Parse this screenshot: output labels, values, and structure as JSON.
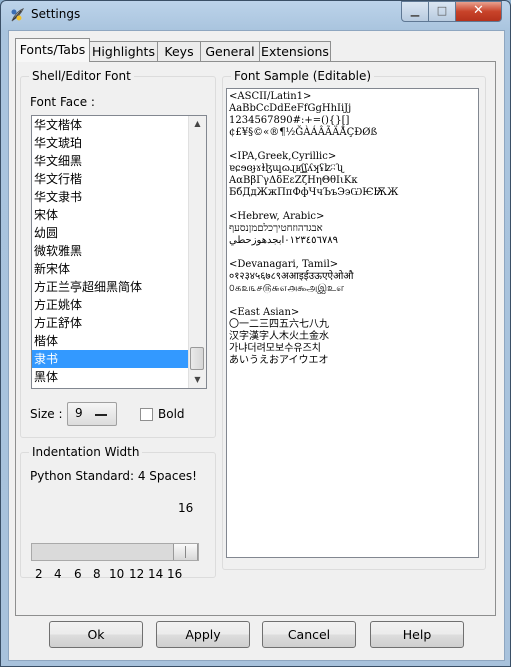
{
  "window": {
    "title": "Settings",
    "close_glyph": "✕"
  },
  "tabs": [
    {
      "label": "Fonts/Tabs",
      "active": true
    },
    {
      "label": "Highlights"
    },
    {
      "label": "Keys"
    },
    {
      "label": "General"
    },
    {
      "label": "Extensions"
    }
  ],
  "font_panel": {
    "group_title": "Shell/Editor Font",
    "face_label": "Font Face :",
    "font_list": [
      "华文楷体",
      "华文琥珀",
      "华文细黑",
      "华文行楷",
      "华文隶书",
      "宋体",
      "幼圆",
      "微软雅黑",
      "新宋体",
      "方正兰亭超细黑简体",
      "方正姚体",
      "方正舒体",
      "楷体",
      "隶书",
      "黑体"
    ],
    "selected_font": "隶书",
    "size_label": "Size :",
    "size_value": "9",
    "bold_label": "Bold",
    "bold_checked": false
  },
  "indent_panel": {
    "group_title": "Indentation Width",
    "standard_text": "Python Standard: 4 Spaces!",
    "value": "16",
    "ticks": [
      "2",
      "4",
      "6",
      "8",
      "10",
      "12",
      "14",
      "16"
    ],
    "level": 16,
    "min": 2,
    "max": 16
  },
  "sample_panel": {
    "group_title": "Font Sample (Editable)",
    "lines": [
      "<ASCII/Latin1>",
      "AaBbCcDdEeFfGgHhIiJj",
      "1234567890#:+=(){}[]",
      "¢£¥§©«®¶½ĞÀÁÂÃÄÅÇÐØß",
      "",
      "<IPA,Greek,Cyrillic>",
      "ɐɕɘɞɟɤɫɮɰɷɻʁʃʆʎʞʢʫʭʯ",
      "ΑαΒβΓγΔδΕεΖζΗηΘθΙιΚκ",
      "БбДдЖжПпФфЧчЪъЭэѠѤѬЖ",
      "",
      "<Hebrew, Arabic>",
      "אבגדהוזחטיךכלםמןנסעף",
      "٠١٢٣٤٥٦٧٨٩ابجدهوزحطي",
      "",
      "<Devanagari, Tamil>",
      "०१२३४५६७८९अआइईउऊएऐओऔ",
      "௦௧௨௩௪௫௬௭௮௯அஇஉஎ",
      "",
      "<East Asian>",
      "〇一二三四五六七八九",
      "汉字漢字人木火土金水",
      "가냐더려모보수유즈치",
      "あいうえおアイウエオ"
    ]
  },
  "buttons": {
    "ok": "Ok",
    "apply": "Apply",
    "cancel": "Cancel",
    "help": "Help"
  }
}
